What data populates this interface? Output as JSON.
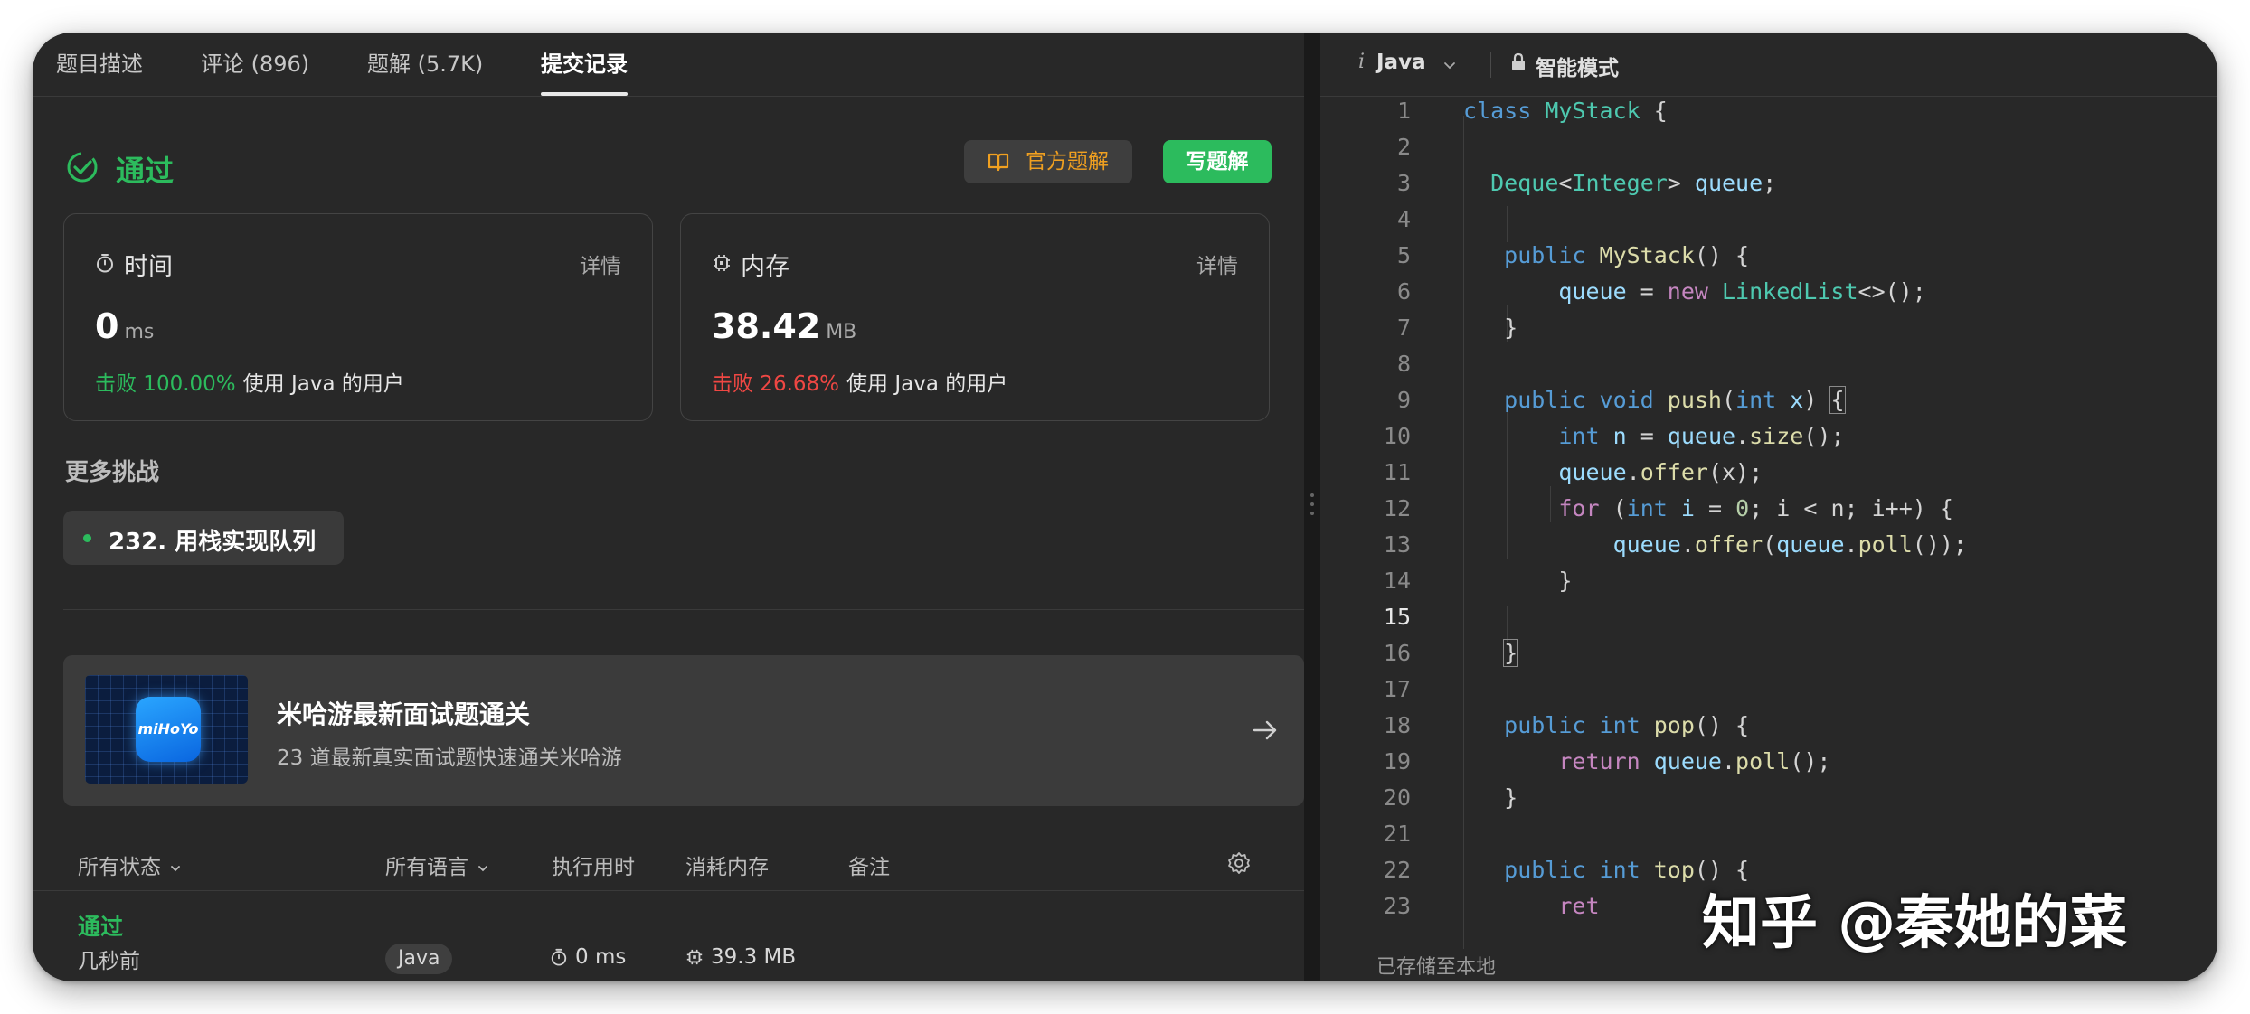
{
  "tabs": [
    {
      "label": "题目描述"
    },
    {
      "label": "评论 (896)"
    },
    {
      "label": "题解 (5.7K)"
    },
    {
      "label": "提交记录"
    }
  ],
  "result": {
    "status": "通过",
    "official_solution_label": "官方题解",
    "write_solution_label": "写题解"
  },
  "time_card": {
    "title": "时间",
    "detail": "详情",
    "value": "0",
    "unit": "ms",
    "beat": "击败 100.00%",
    "beat_suffix": "使用 Java 的用户"
  },
  "memory_card": {
    "title": "内存",
    "detail": "详情",
    "value": "38.42",
    "unit": "MB",
    "beat": "击败 26.68%",
    "beat_suffix": "使用 Java 的用户"
  },
  "more": {
    "label": "更多挑战",
    "challenge": "232. 用栈实现队列"
  },
  "promo": {
    "logo_text": "miHoYo",
    "title": "米哈游最新面试题通关",
    "subtitle": "23 道最新真实面试题快速通关米哈游"
  },
  "table": {
    "headers": {
      "status": "所有状态",
      "language": "所有语言",
      "runtime": "执行用时",
      "memory": "消耗内存",
      "note": "备注"
    },
    "row": {
      "status": "通过",
      "time": "几秒前",
      "language": "Java",
      "runtime": "0 ms",
      "memory": "39.3 MB"
    }
  },
  "editor": {
    "language": "Java",
    "mode": "智能模式",
    "saved": "已存储至本地",
    "current_line": 15,
    "lines": [
      [
        [
          "kw",
          "class "
        ],
        [
          "type",
          "MyStack"
        ],
        [
          "def",
          " {"
        ]
      ],
      [],
      [
        [
          "def",
          "  "
        ],
        [
          "type",
          "Deque"
        ],
        [
          "def",
          "<"
        ],
        [
          "type",
          "Integer"
        ],
        [
          "def",
          "> "
        ],
        [
          "var",
          "queue"
        ],
        [
          "def",
          ";"
        ]
      ],
      [],
      [
        [
          "def",
          "   "
        ],
        [
          "kw",
          "public "
        ],
        [
          "fn",
          "MyStack"
        ],
        [
          "def",
          "() {"
        ]
      ],
      [
        [
          "def",
          "       "
        ],
        [
          "var",
          "queue"
        ],
        [
          "def",
          " = "
        ],
        [
          "ctl",
          "new "
        ],
        [
          "type",
          "LinkedList"
        ],
        [
          "def",
          "<>();"
        ]
      ],
      [
        [
          "def",
          "   }"
        ]
      ],
      [],
      [
        [
          "def",
          "   "
        ],
        [
          "kw",
          "public "
        ],
        [
          "kw",
          "void "
        ],
        [
          "fn",
          "push"
        ],
        [
          "def",
          "("
        ],
        [
          "kw",
          "int "
        ],
        [
          "var",
          "x"
        ],
        [
          "def",
          ") "
        ],
        [
          "box",
          "{"
        ]
      ],
      [
        [
          "def",
          "       "
        ],
        [
          "kw",
          "int "
        ],
        [
          "var",
          "n"
        ],
        [
          "def",
          " = "
        ],
        [
          "var",
          "queue"
        ],
        [
          "def",
          "."
        ],
        [
          "fn",
          "size"
        ],
        [
          "def",
          "();"
        ]
      ],
      [
        [
          "def",
          "       "
        ],
        [
          "var",
          "queue"
        ],
        [
          "def",
          "."
        ],
        [
          "fn",
          "offer"
        ],
        [
          "def",
          "(x);"
        ]
      ],
      [
        [
          "def",
          "       "
        ],
        [
          "ctl",
          "for "
        ],
        [
          "def",
          "("
        ],
        [
          "kw",
          "int "
        ],
        [
          "var",
          "i"
        ],
        [
          "def",
          " = "
        ],
        [
          "num",
          "0"
        ],
        [
          "def",
          "; i < n; i++) {"
        ]
      ],
      [
        [
          "def",
          "           "
        ],
        [
          "var",
          "queue"
        ],
        [
          "def",
          "."
        ],
        [
          "fn",
          "offer"
        ],
        [
          "def",
          "("
        ],
        [
          "var",
          "queue"
        ],
        [
          "def",
          "."
        ],
        [
          "fn",
          "poll"
        ],
        [
          "def",
          "());"
        ]
      ],
      [
        [
          "def",
          "       }"
        ]
      ],
      [],
      [
        [
          "def",
          "   "
        ],
        [
          "box",
          "}"
        ]
      ],
      [],
      [
        [
          "def",
          "   "
        ],
        [
          "kw",
          "public "
        ],
        [
          "kw",
          "int "
        ],
        [
          "fn",
          "pop"
        ],
        [
          "def",
          "() {"
        ]
      ],
      [
        [
          "def",
          "       "
        ],
        [
          "ctl",
          "return "
        ],
        [
          "var",
          "queue"
        ],
        [
          "def",
          "."
        ],
        [
          "fn",
          "poll"
        ],
        [
          "def",
          "();"
        ]
      ],
      [
        [
          "def",
          "   }"
        ]
      ],
      [],
      [
        [
          "def",
          "   "
        ],
        [
          "kw",
          "public "
        ],
        [
          "kw",
          "int "
        ],
        [
          "fn",
          "top"
        ],
        [
          "def",
          "() {"
        ]
      ],
      [
        [
          "def",
          "       "
        ],
        [
          "ctl",
          "ret"
        ]
      ]
    ]
  },
  "watermark": "知乎 @秦她的菜",
  "colors": {
    "accent_green": "#2cbb5d",
    "accent_red": "#ef4743",
    "accent_orange": "#f0a020",
    "panel_bg": "#282828"
  }
}
